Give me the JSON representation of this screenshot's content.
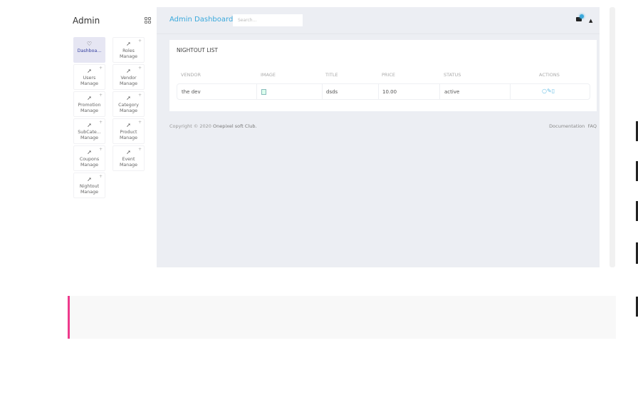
{
  "sidebar": {
    "brand": "Admin",
    "items": [
      {
        "label1": "Dashboa...",
        "label2": "",
        "active": true,
        "icon": "tag-icon"
      },
      {
        "label1": "Roles",
        "label2": "Manage",
        "icon": "rocket-icon"
      },
      {
        "label1": "Users",
        "label2": "Manage",
        "icon": "rocket-icon"
      },
      {
        "label1": "Vendor",
        "label2": "Manage",
        "icon": "rocket-icon"
      },
      {
        "label1": "Promotion",
        "label2": "Manage",
        "icon": "rocket-icon"
      },
      {
        "label1": "Category",
        "label2": "Manage",
        "icon": "rocket-icon"
      },
      {
        "label1": "SubCate...",
        "label2": "Manage",
        "icon": "rocket-icon"
      },
      {
        "label1": "Product",
        "label2": "Manage",
        "icon": "rocket-icon"
      },
      {
        "label1": "Coupons",
        "label2": "Manage",
        "icon": "rocket-icon"
      },
      {
        "label1": "Event",
        "label2": "Manage",
        "icon": "rocket-icon"
      },
      {
        "label1": "Nightout",
        "label2": "Manage",
        "icon": "rocket-icon"
      }
    ]
  },
  "header": {
    "title": "Admin Dashboard",
    "search_placeholder": "Search..."
  },
  "card": {
    "title": "NIGHTOUT LIST",
    "columns": [
      "VENDOR",
      "IMAGE",
      "TITLE",
      "PRICE",
      "STATUS",
      "ACTIONS"
    ],
    "rows": [
      {
        "vendor": "the dev",
        "title": "dsds",
        "price": "10.00",
        "status": "active"
      }
    ]
  },
  "footer": {
    "copyright": "Copyright © 2020",
    "company": "Onepixel soft Club.",
    "documentation": "Documentation",
    "faq": "FAQ"
  },
  "colors": {
    "accent": "#3aa9dc",
    "highlight": "#ee3a8c"
  }
}
